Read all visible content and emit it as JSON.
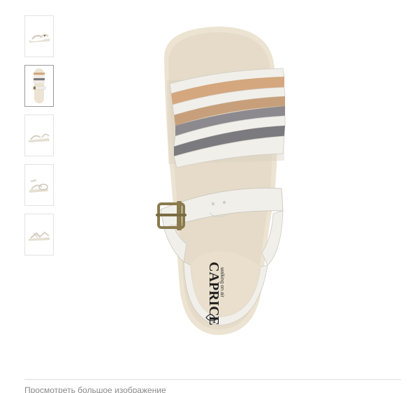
{
  "gallery": {
    "thumbnails": [
      {
        "view": "side",
        "icon": "sandal-side-thumbnail-icon",
        "selected": false
      },
      {
        "view": "top",
        "icon": "sandal-top-thumbnail-icon",
        "selected": true
      },
      {
        "view": "side-alt",
        "icon": "sandal-side-alt-thumbnail-icon",
        "selected": false
      },
      {
        "view": "pair",
        "icon": "sandal-pair-thumbnail-icon",
        "selected": false
      },
      {
        "view": "sole",
        "icon": "sandal-sole-thumbnail-icon",
        "selected": false
      }
    ],
    "main_image": {
      "icon": "sandal-top-view-image",
      "brand_logo_text": "CAPRICE",
      "brand_tagline": "walking on air"
    },
    "view_larger_label": "Просмотреть большое изображение"
  },
  "colors": {
    "strap_white": "#f1efea",
    "strap_tan": "#d4a77e",
    "strap_gray": "#7b7a7e",
    "insole": "#ece3d2",
    "buckle": "#8a7a4e"
  }
}
